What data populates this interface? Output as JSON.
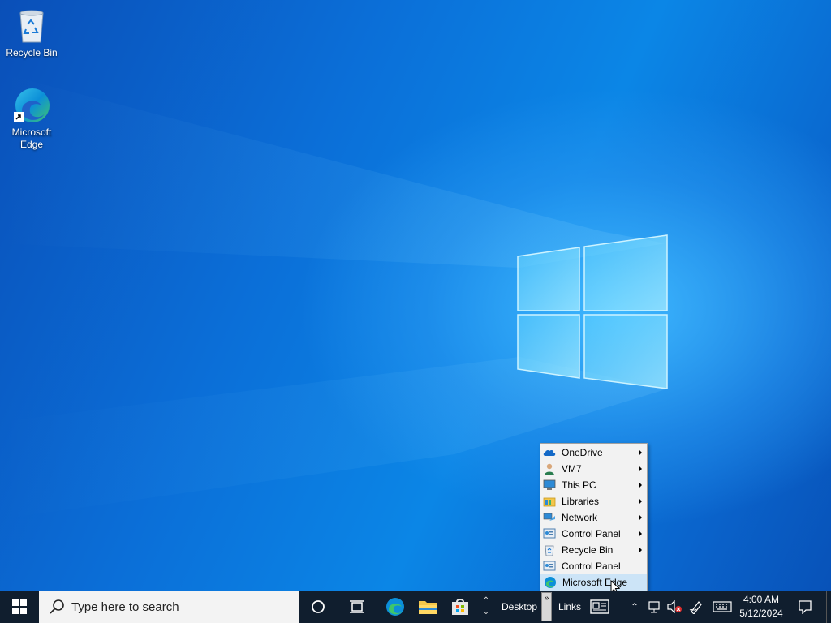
{
  "desktop": {
    "icons": [
      {
        "label": "Recycle Bin",
        "icon": "recycle-bin-icon"
      },
      {
        "label": "Microsoft Edge",
        "icon": "edge-icon"
      }
    ]
  },
  "context_menu": {
    "items": [
      {
        "label": "OneDrive",
        "icon": "onedrive-icon",
        "submenu": true
      },
      {
        "label": "VM7",
        "icon": "user-icon",
        "submenu": true
      },
      {
        "label": "This PC",
        "icon": "computer-icon",
        "submenu": true
      },
      {
        "label": "Libraries",
        "icon": "libraries-icon",
        "submenu": true
      },
      {
        "label": "Network",
        "icon": "network-icon",
        "submenu": true
      },
      {
        "label": "Control Panel",
        "icon": "control-panel-icon",
        "submenu": true
      },
      {
        "label": "Recycle Bin",
        "icon": "recycle-bin-icon",
        "submenu": true
      },
      {
        "label": "Control Panel",
        "icon": "control-panel-icon",
        "submenu": false
      },
      {
        "label": "Microsoft Edge",
        "icon": "edge-icon",
        "submenu": false,
        "hovered": true
      }
    ]
  },
  "taskbar": {
    "search_placeholder": "Type here to search",
    "toolbars": {
      "desktop_label": "Desktop",
      "links_label": "Links"
    },
    "clock": {
      "time": "4:00 AM",
      "date": "5/12/2024"
    },
    "pinned": [
      "edge-icon",
      "file-explorer-icon",
      "store-icon"
    ]
  },
  "colors": {
    "taskbar_bg": "#101e2e",
    "menu_bg": "#f2f2f2",
    "menu_hover": "#cce4f7",
    "desktop_blue": "#0b6fd8"
  }
}
